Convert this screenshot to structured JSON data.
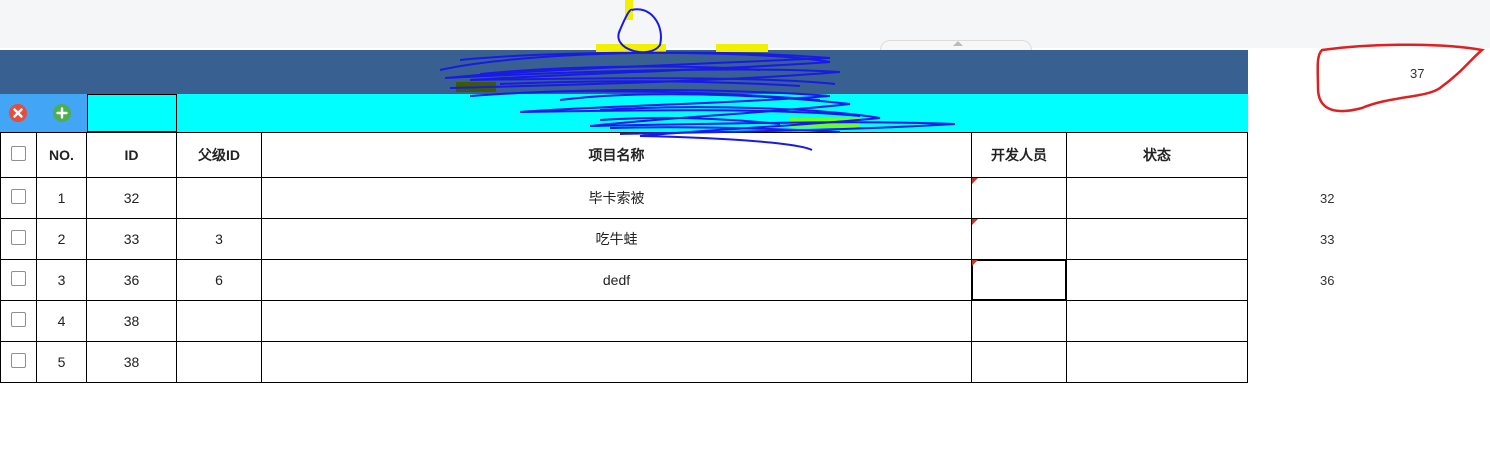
{
  "toolbar": {
    "delete_icon": "close-circle-icon",
    "add_icon": "plus-circle-icon",
    "delete_color": "#e74c3c",
    "add_color": "#4caf50"
  },
  "colors": {
    "header_band": "#386191",
    "toolbar_bg": "#00ffff",
    "button_area": "#42a5f5",
    "dirty_marker": "#c0392b"
  },
  "table": {
    "headers": {
      "no": "NO.",
      "id": "ID",
      "parent_id": "父级ID",
      "project_name": "项目名称",
      "developer": "开发人员",
      "status": "状态"
    },
    "rows": [
      {
        "no": "1",
        "id": "32",
        "parent_id": "",
        "project_name": "毕卡索被",
        "developer": "",
        "status": ""
      },
      {
        "no": "2",
        "id": "33",
        "parent_id": "3",
        "project_name": "吃牛蛙",
        "developer": "",
        "status": ""
      },
      {
        "no": "3",
        "id": "36",
        "parent_id": "6",
        "project_name": "dedf",
        "developer": "",
        "status": ""
      },
      {
        "no": "4",
        "id": "38",
        "parent_id": "",
        "project_name": "",
        "developer": "",
        "status": ""
      },
      {
        "no": "5",
        "id": "38",
        "parent_id": "",
        "project_name": "",
        "developer": "",
        "status": ""
      }
    ]
  },
  "side_values": [
    "32",
    "33",
    "36"
  ],
  "count_badge": "37"
}
